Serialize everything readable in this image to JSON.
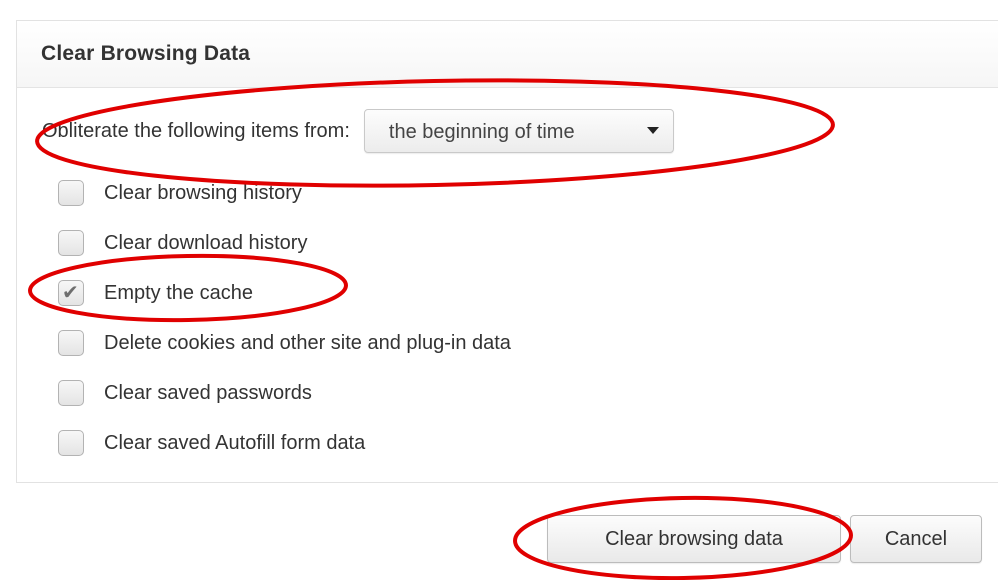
{
  "dialog": {
    "title": "Clear Browsing Data",
    "time_range": {
      "label": "Obliterate the following items from:",
      "selected": "the beginning of time"
    },
    "options": [
      {
        "label": "Clear browsing history",
        "checked": false
      },
      {
        "label": "Clear download history",
        "checked": false
      },
      {
        "label": "Empty the cache",
        "checked": true
      },
      {
        "label": "Delete cookies and other site and plug-in data",
        "checked": false
      },
      {
        "label": "Clear saved passwords",
        "checked": false
      },
      {
        "label": "Clear saved Autofill form data",
        "checked": false
      }
    ],
    "buttons": {
      "clear_label": "Clear browsing data",
      "cancel_label": "Cancel"
    }
  },
  "annotation_color": "#e00000"
}
